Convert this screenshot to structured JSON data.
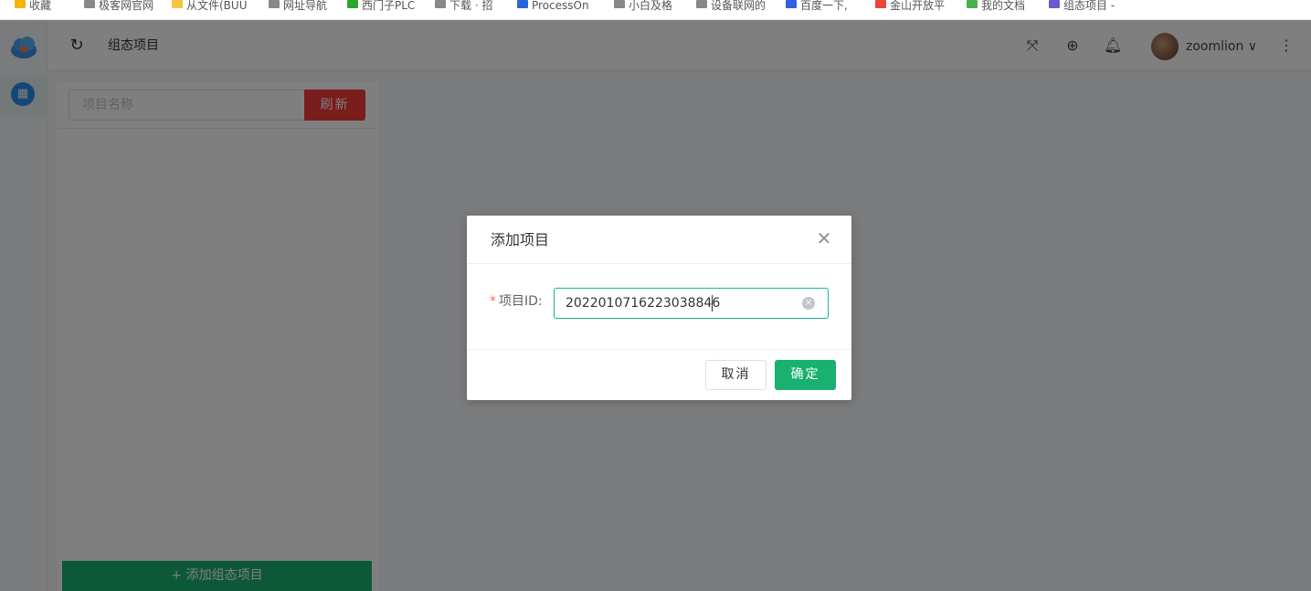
{
  "bookmarks": [
    {
      "label": "收藏",
      "color": "#f5b400"
    },
    {
      "label": "极客网官网",
      "color": "#888888"
    },
    {
      "label": "从文件(BUU",
      "color": "#f5c542"
    },
    {
      "label": "网址导航",
      "color": "#888888"
    },
    {
      "label": "西门子PLC",
      "color": "#2aa52a"
    },
    {
      "label": "下载 · 招",
      "color": "#888888"
    },
    {
      "label": "ProcessOn",
      "color": "#2b63d9"
    },
    {
      "label": "小白及格",
      "color": "#888888"
    },
    {
      "label": "设备联网的",
      "color": "#888888"
    },
    {
      "label": "百度一下,",
      "color": "#3060e0"
    },
    {
      "label": "金山开放平",
      "color": "#e8463a"
    },
    {
      "label": "我的文档",
      "color": "#4caf50"
    },
    {
      "label": "组态项目 -",
      "color": "#6a5acd"
    }
  ],
  "topbar": {
    "page_title": "组态项目",
    "username": "zoomlion ∨"
  },
  "panel": {
    "search_placeholder": "项目名称",
    "refresh_label": "刷新",
    "add_project_label": "+ 添加组态项目"
  },
  "modal": {
    "title": "添加项目",
    "close_glyph": "✕",
    "field_label": "项目ID:",
    "required_mark": "*",
    "field_value": "2022010716223038846",
    "cancel_label": "取消",
    "confirm_label": "确定"
  },
  "colors": {
    "accent_green": "#1ab070",
    "refresh_red": "#f23b3b",
    "overlay": "rgba(0,0,0,0.5)"
  }
}
